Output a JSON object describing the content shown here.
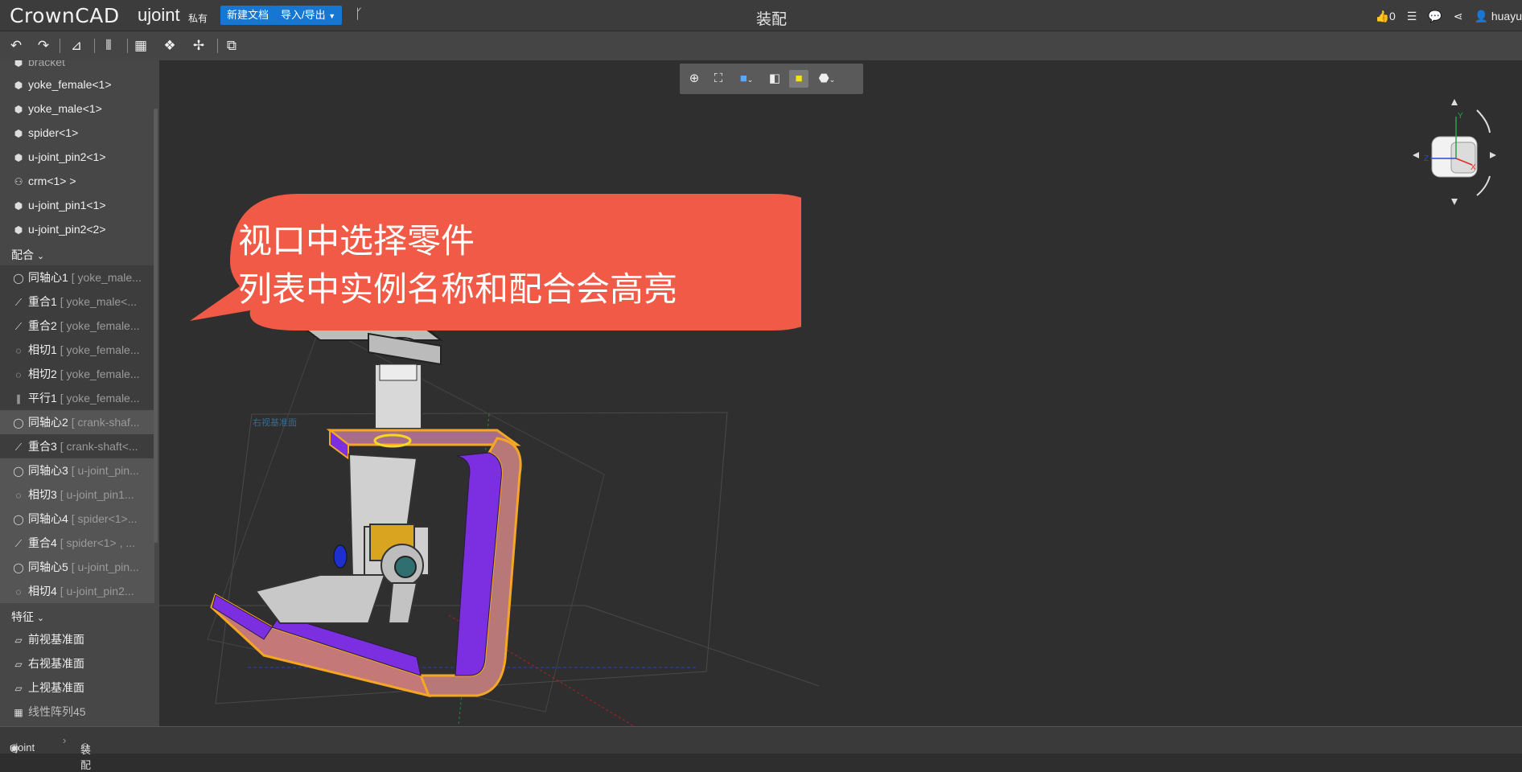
{
  "header": {
    "logo": "CrownCAD",
    "doc_name": "ujoint",
    "privacy": "私有",
    "new_doc": "新建文档",
    "import_export": "导入/导出",
    "title": "装配",
    "likes": "0",
    "user": "huayu"
  },
  "sidebar": {
    "parts": [
      {
        "icon": "part-icon",
        "label": "yoke_female<1>"
      },
      {
        "icon": "part-icon",
        "label": "yoke_male<1>"
      },
      {
        "icon": "part-icon",
        "label": "spider<1>"
      },
      {
        "icon": "part-icon",
        "label": "u-joint_pin2<1>"
      },
      {
        "icon": "assembly-icon",
        "label": "crm<1> >"
      },
      {
        "icon": "part-icon",
        "label": "u-joint_pin1<1>"
      },
      {
        "icon": "part-icon",
        "label": "u-joint_pin2<2>"
      }
    ],
    "mates_section": "配合",
    "mates": [
      {
        "icon": "concentric-icon",
        "label": "同轴心1",
        "ref": "[ yoke_male..."
      },
      {
        "icon": "coincident-icon",
        "label": "重合1",
        "ref": "[ yoke_male<..."
      },
      {
        "icon": "coincident-icon",
        "label": "重合2",
        "ref": "[ yoke_female..."
      },
      {
        "icon": "tangent-icon",
        "label": "相切1",
        "ref": "[ yoke_female..."
      },
      {
        "icon": "tangent-icon",
        "label": "相切2",
        "ref": "[ yoke_female..."
      },
      {
        "icon": "parallel-icon",
        "label": "平行1",
        "ref": "[ yoke_female..."
      },
      {
        "icon": "concentric-icon",
        "label": "同轴心2",
        "ref": "[ crank-shaf..."
      },
      {
        "icon": "coincident-icon",
        "label": "重合3",
        "ref": "[ crank-shaft<..."
      },
      {
        "icon": "concentric-icon",
        "label": "同轴心3",
        "ref": "[ u-joint_pin..."
      },
      {
        "icon": "tangent-icon",
        "label": "相切3",
        "ref": "[ u-joint_pin1..."
      },
      {
        "icon": "concentric-icon",
        "label": "同轴心4",
        "ref": "[ spider<1>..."
      },
      {
        "icon": "coincident-icon",
        "label": "重合4",
        "ref": "[ spider<1> , ..."
      },
      {
        "icon": "concentric-icon",
        "label": "同轴心5",
        "ref": "[ u-joint_pin..."
      },
      {
        "icon": "tangent-icon",
        "label": "相切4",
        "ref": "[ u-joint_pin2..."
      }
    ],
    "features_section": "特征",
    "features": [
      {
        "icon": "plane-icon",
        "label": "前视基准面"
      },
      {
        "icon": "plane-icon",
        "label": "右视基准面"
      },
      {
        "icon": "plane-icon",
        "label": "上视基准面"
      },
      {
        "icon": "pattern-icon",
        "label": "线性阵列45"
      }
    ]
  },
  "callout": {
    "line1": "视口中选择零件",
    "line2": "列表中实例名称和配合会高亮"
  },
  "viewport": {
    "plane_label": "右视基准面"
  },
  "statusbar": {
    "doc": "ujoint",
    "assembly": "装配"
  },
  "colors": {
    "accent": "#1677d2",
    "callout": "#f05a46",
    "highlight": "#f5a623"
  }
}
